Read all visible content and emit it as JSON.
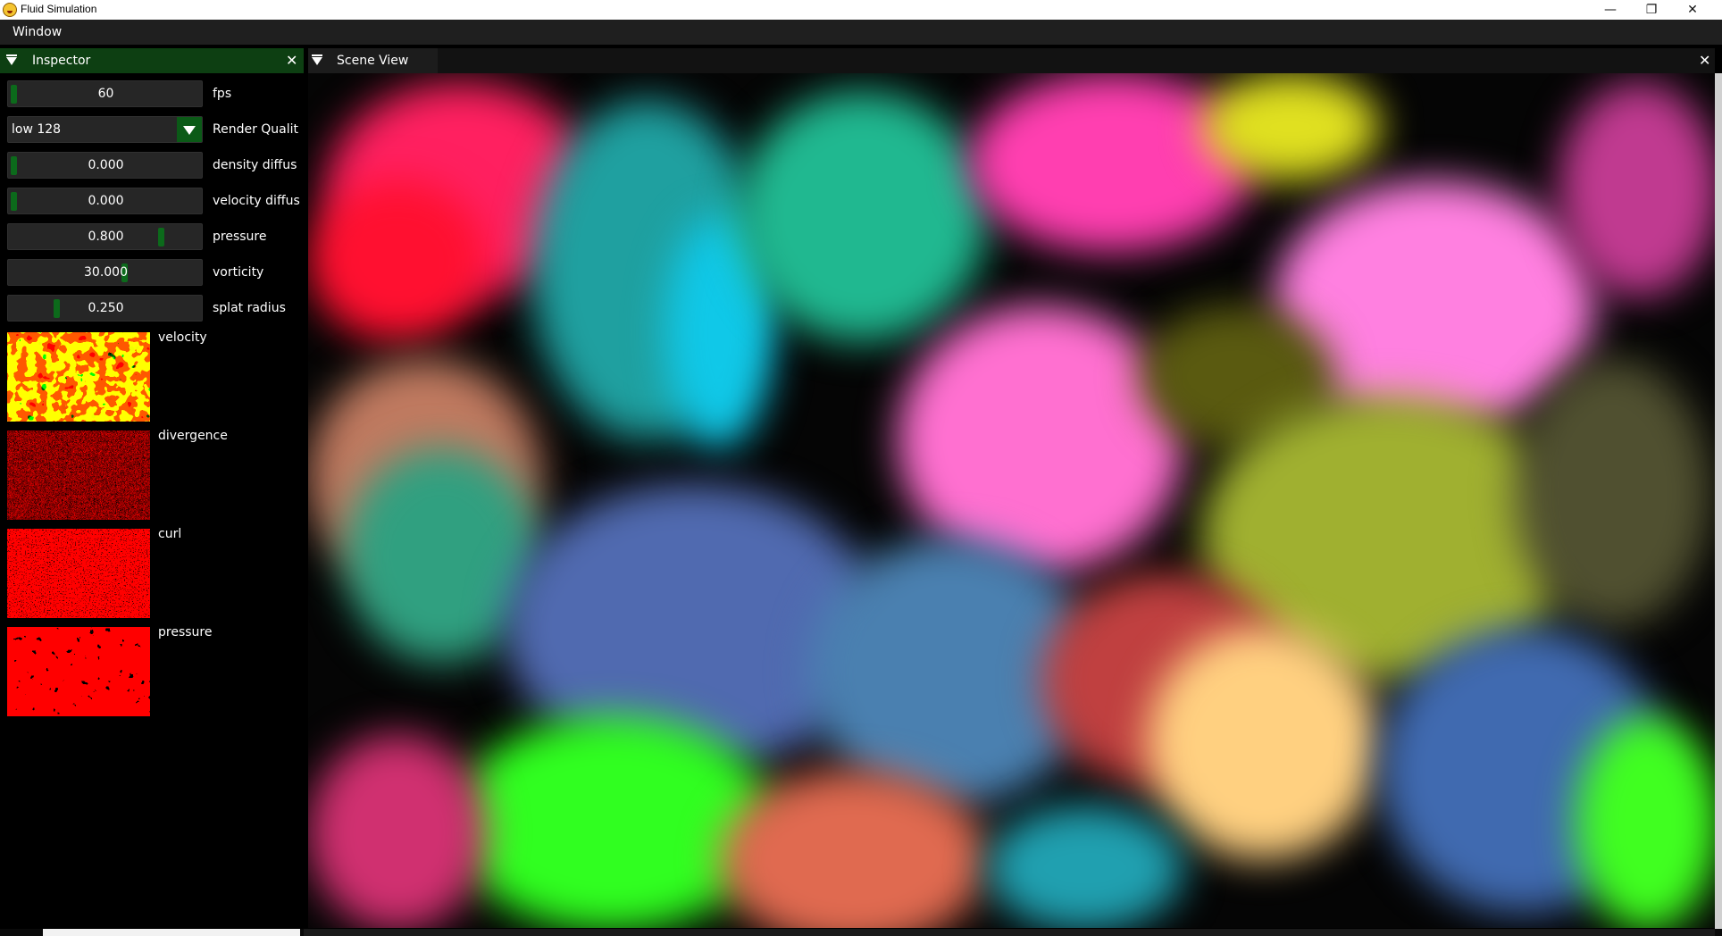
{
  "window": {
    "title": "Fluid Simulation"
  },
  "menu": {
    "items": [
      "Window"
    ]
  },
  "inspector": {
    "tab_label": "Inspector",
    "controls": [
      {
        "name": "fps",
        "value": "60",
        "label": "fps",
        "slider_fraction": 0.0
      },
      {
        "name": "render-quality",
        "value": "low 128",
        "label": "Render Qualit"
      },
      {
        "name": "density-diffus",
        "value": "0.000",
        "label": "density diffus",
        "slider_fraction": 0.0
      },
      {
        "name": "velocity-diffus",
        "value": "0.000",
        "label": "velocity diffus",
        "slider_fraction": 0.0
      },
      {
        "name": "pressure",
        "value": "0.800",
        "label": "pressure",
        "slider_fraction": 0.8
      },
      {
        "name": "vorticity",
        "value": "30.000",
        "label": "vorticity",
        "slider_fraction": 0.5
      },
      {
        "name": "splat-radius",
        "value": "0.250",
        "label": "splat radius",
        "slider_fraction": 0.21
      }
    ],
    "textures": [
      {
        "name": "velocity",
        "label": "velocity"
      },
      {
        "name": "divergence",
        "label": "divergence"
      },
      {
        "name": "curl",
        "label": "curl"
      },
      {
        "name": "pressure",
        "label": "pressure"
      }
    ]
  },
  "scene": {
    "tab_label": "Scene View"
  },
  "icons": {
    "app": "app-icon",
    "collapse": "triangle-down-icon",
    "close": "close-icon",
    "minimize": "minimize-icon",
    "restore": "restore-icon",
    "combo": "chevron-down-icon"
  },
  "colors": {
    "accent": "#0b5a17",
    "tab_active": "#0d3f12",
    "panel_bg": "#000000",
    "field_bg": "#262626"
  }
}
